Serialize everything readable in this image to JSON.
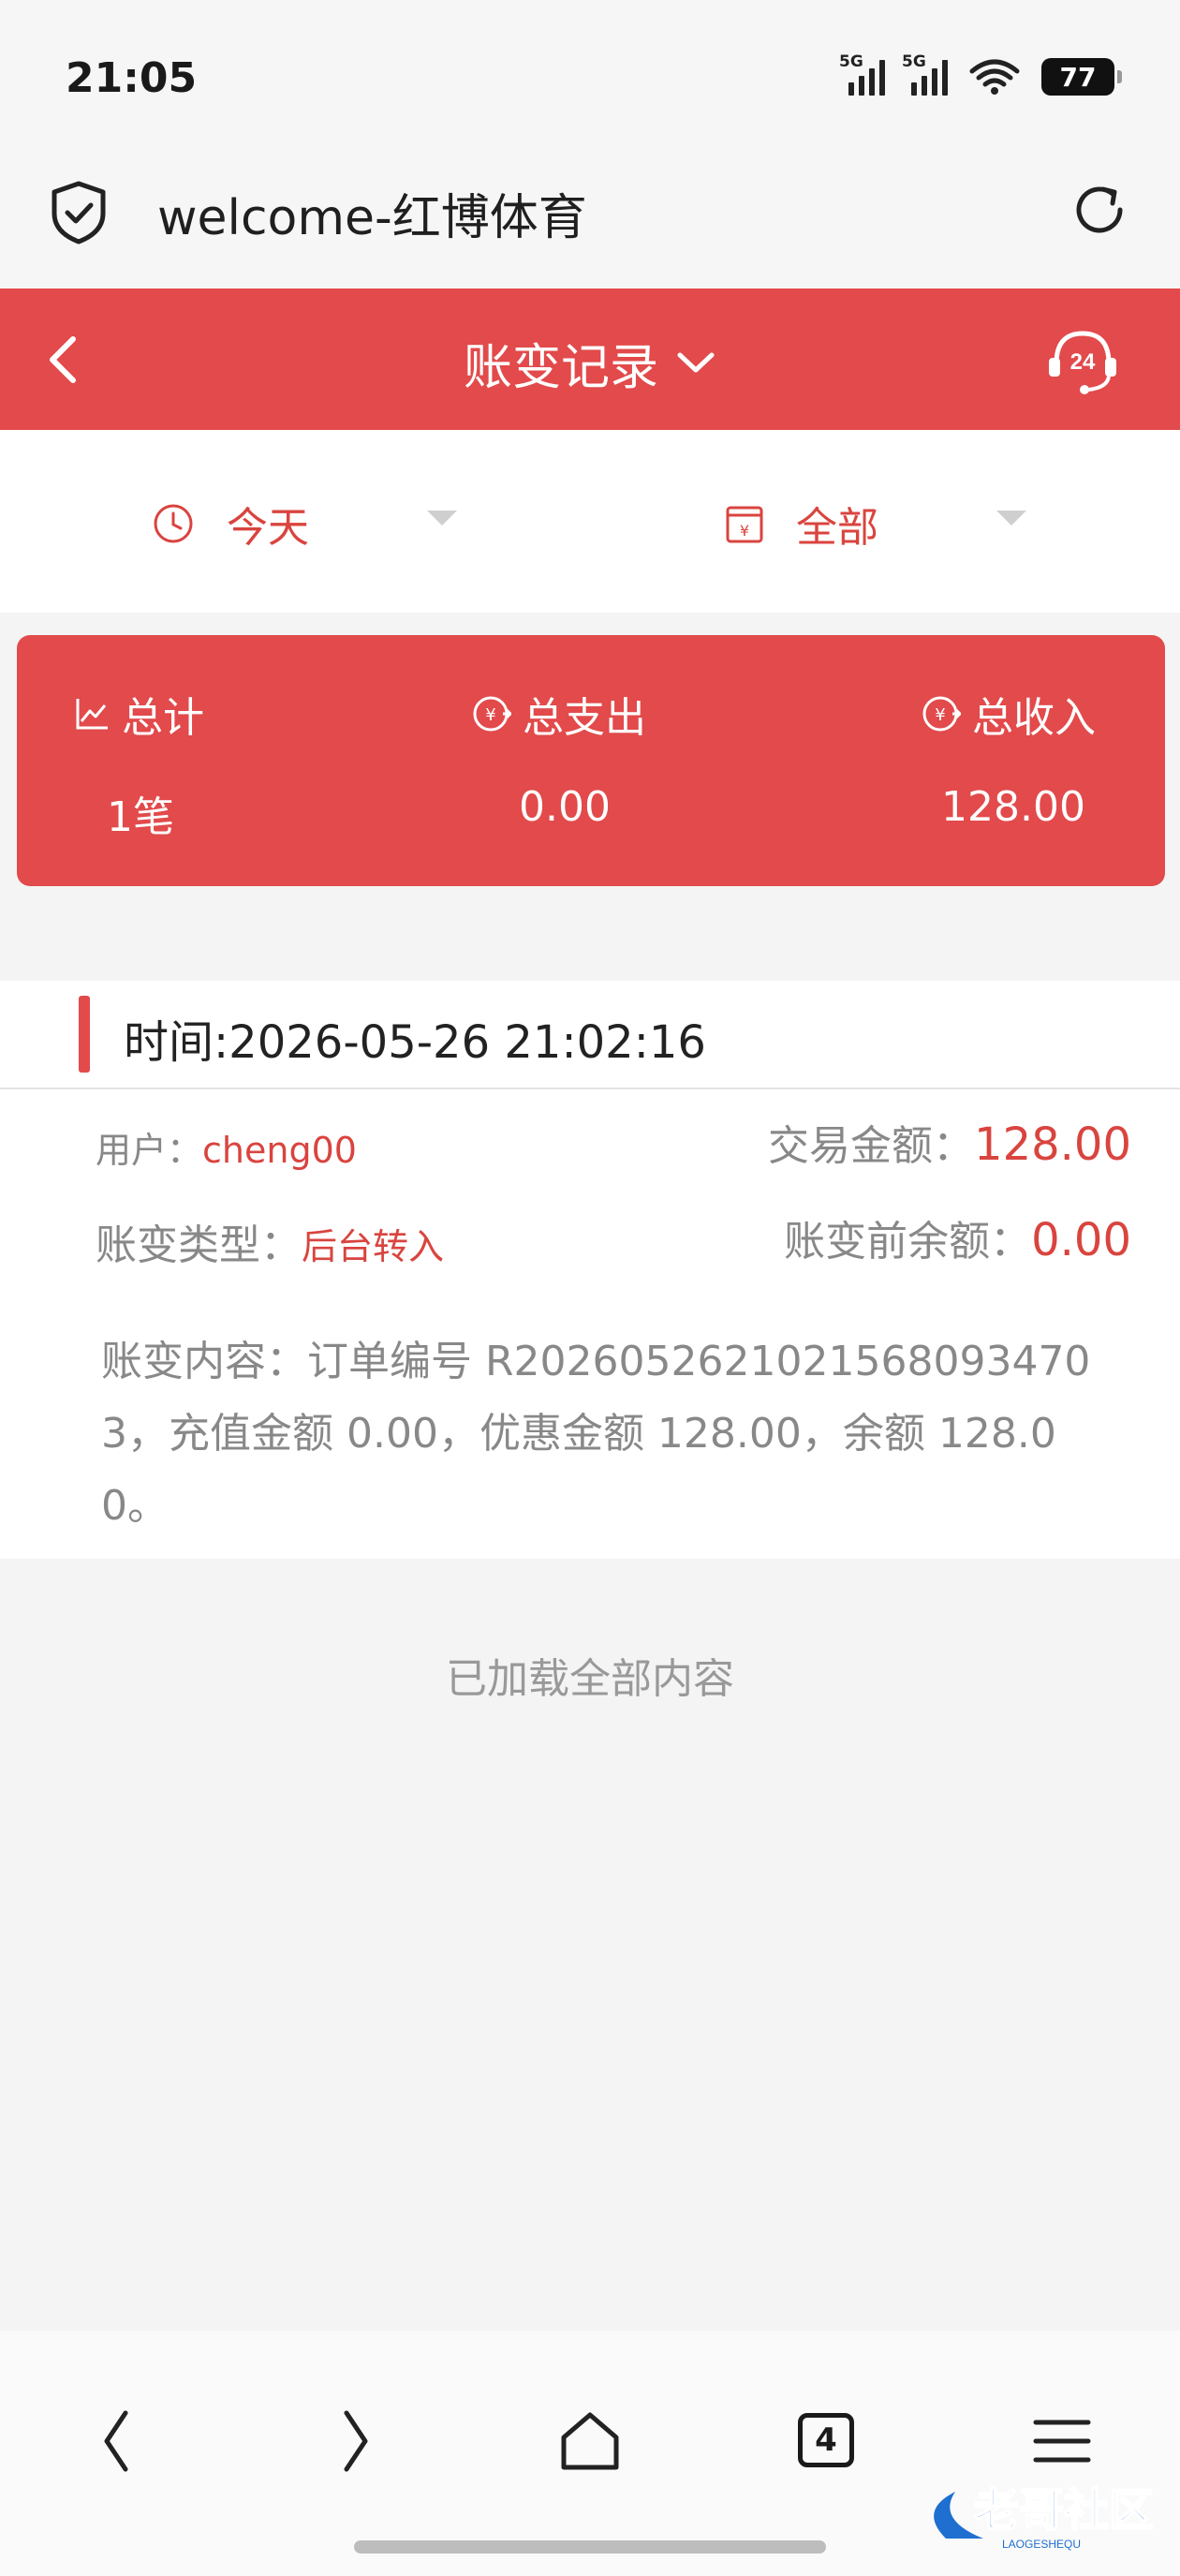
{
  "status_bar": {
    "time": "21:05",
    "signal1_tag": "5G",
    "signal2_tag": "5G",
    "battery": "77",
    "icons": [
      "signal-5g-icon",
      "signal-5g-icon",
      "wifi-icon",
      "battery-icon"
    ]
  },
  "browser": {
    "title": "welcome-红博体育",
    "icons": [
      "shield-check-icon",
      "reload-icon"
    ]
  },
  "header": {
    "title": "账变记录",
    "accent": "#e24a4b",
    "icons": [
      "back-arrow-icon",
      "chevron-down-icon",
      "support-24h-icon"
    ],
    "support_text": "24"
  },
  "filters": {
    "date_label": "今天",
    "type_label": "全部",
    "icons": [
      "clock-icon",
      "calendar-yuan-icon",
      "caret-down-icon"
    ]
  },
  "summary": {
    "total_label": "总计",
    "total_value": "1笔",
    "expense_label": "总支出",
    "expense_value": "0.00",
    "income_label": "总收入",
    "income_value": "128.00"
  },
  "record": {
    "time": "时间:2026-05-26 21:02:16",
    "user_label": "用户：",
    "user_value": "cheng00",
    "amount_label": "交易金额：",
    "amount_value": "128.00",
    "type_label": "账变类型：",
    "type_value": "后台转入",
    "balance_label": "账变前余额：",
    "balance_value": "0.00",
    "content": "账变内容：订单编号 R2026052621021568093470 3，充值金额 0.00，优惠金额 128.00，余额 128.00。"
  },
  "footer_text": "已加载全部内容",
  "bottom_nav": {
    "tabs_count": "4",
    "icons": [
      "back-icon",
      "forward-icon",
      "home-icon",
      "tabs-icon",
      "menu-icon"
    ]
  },
  "watermark_text": "老哥社区",
  "watermark_sub": "LAOGESHEQU"
}
